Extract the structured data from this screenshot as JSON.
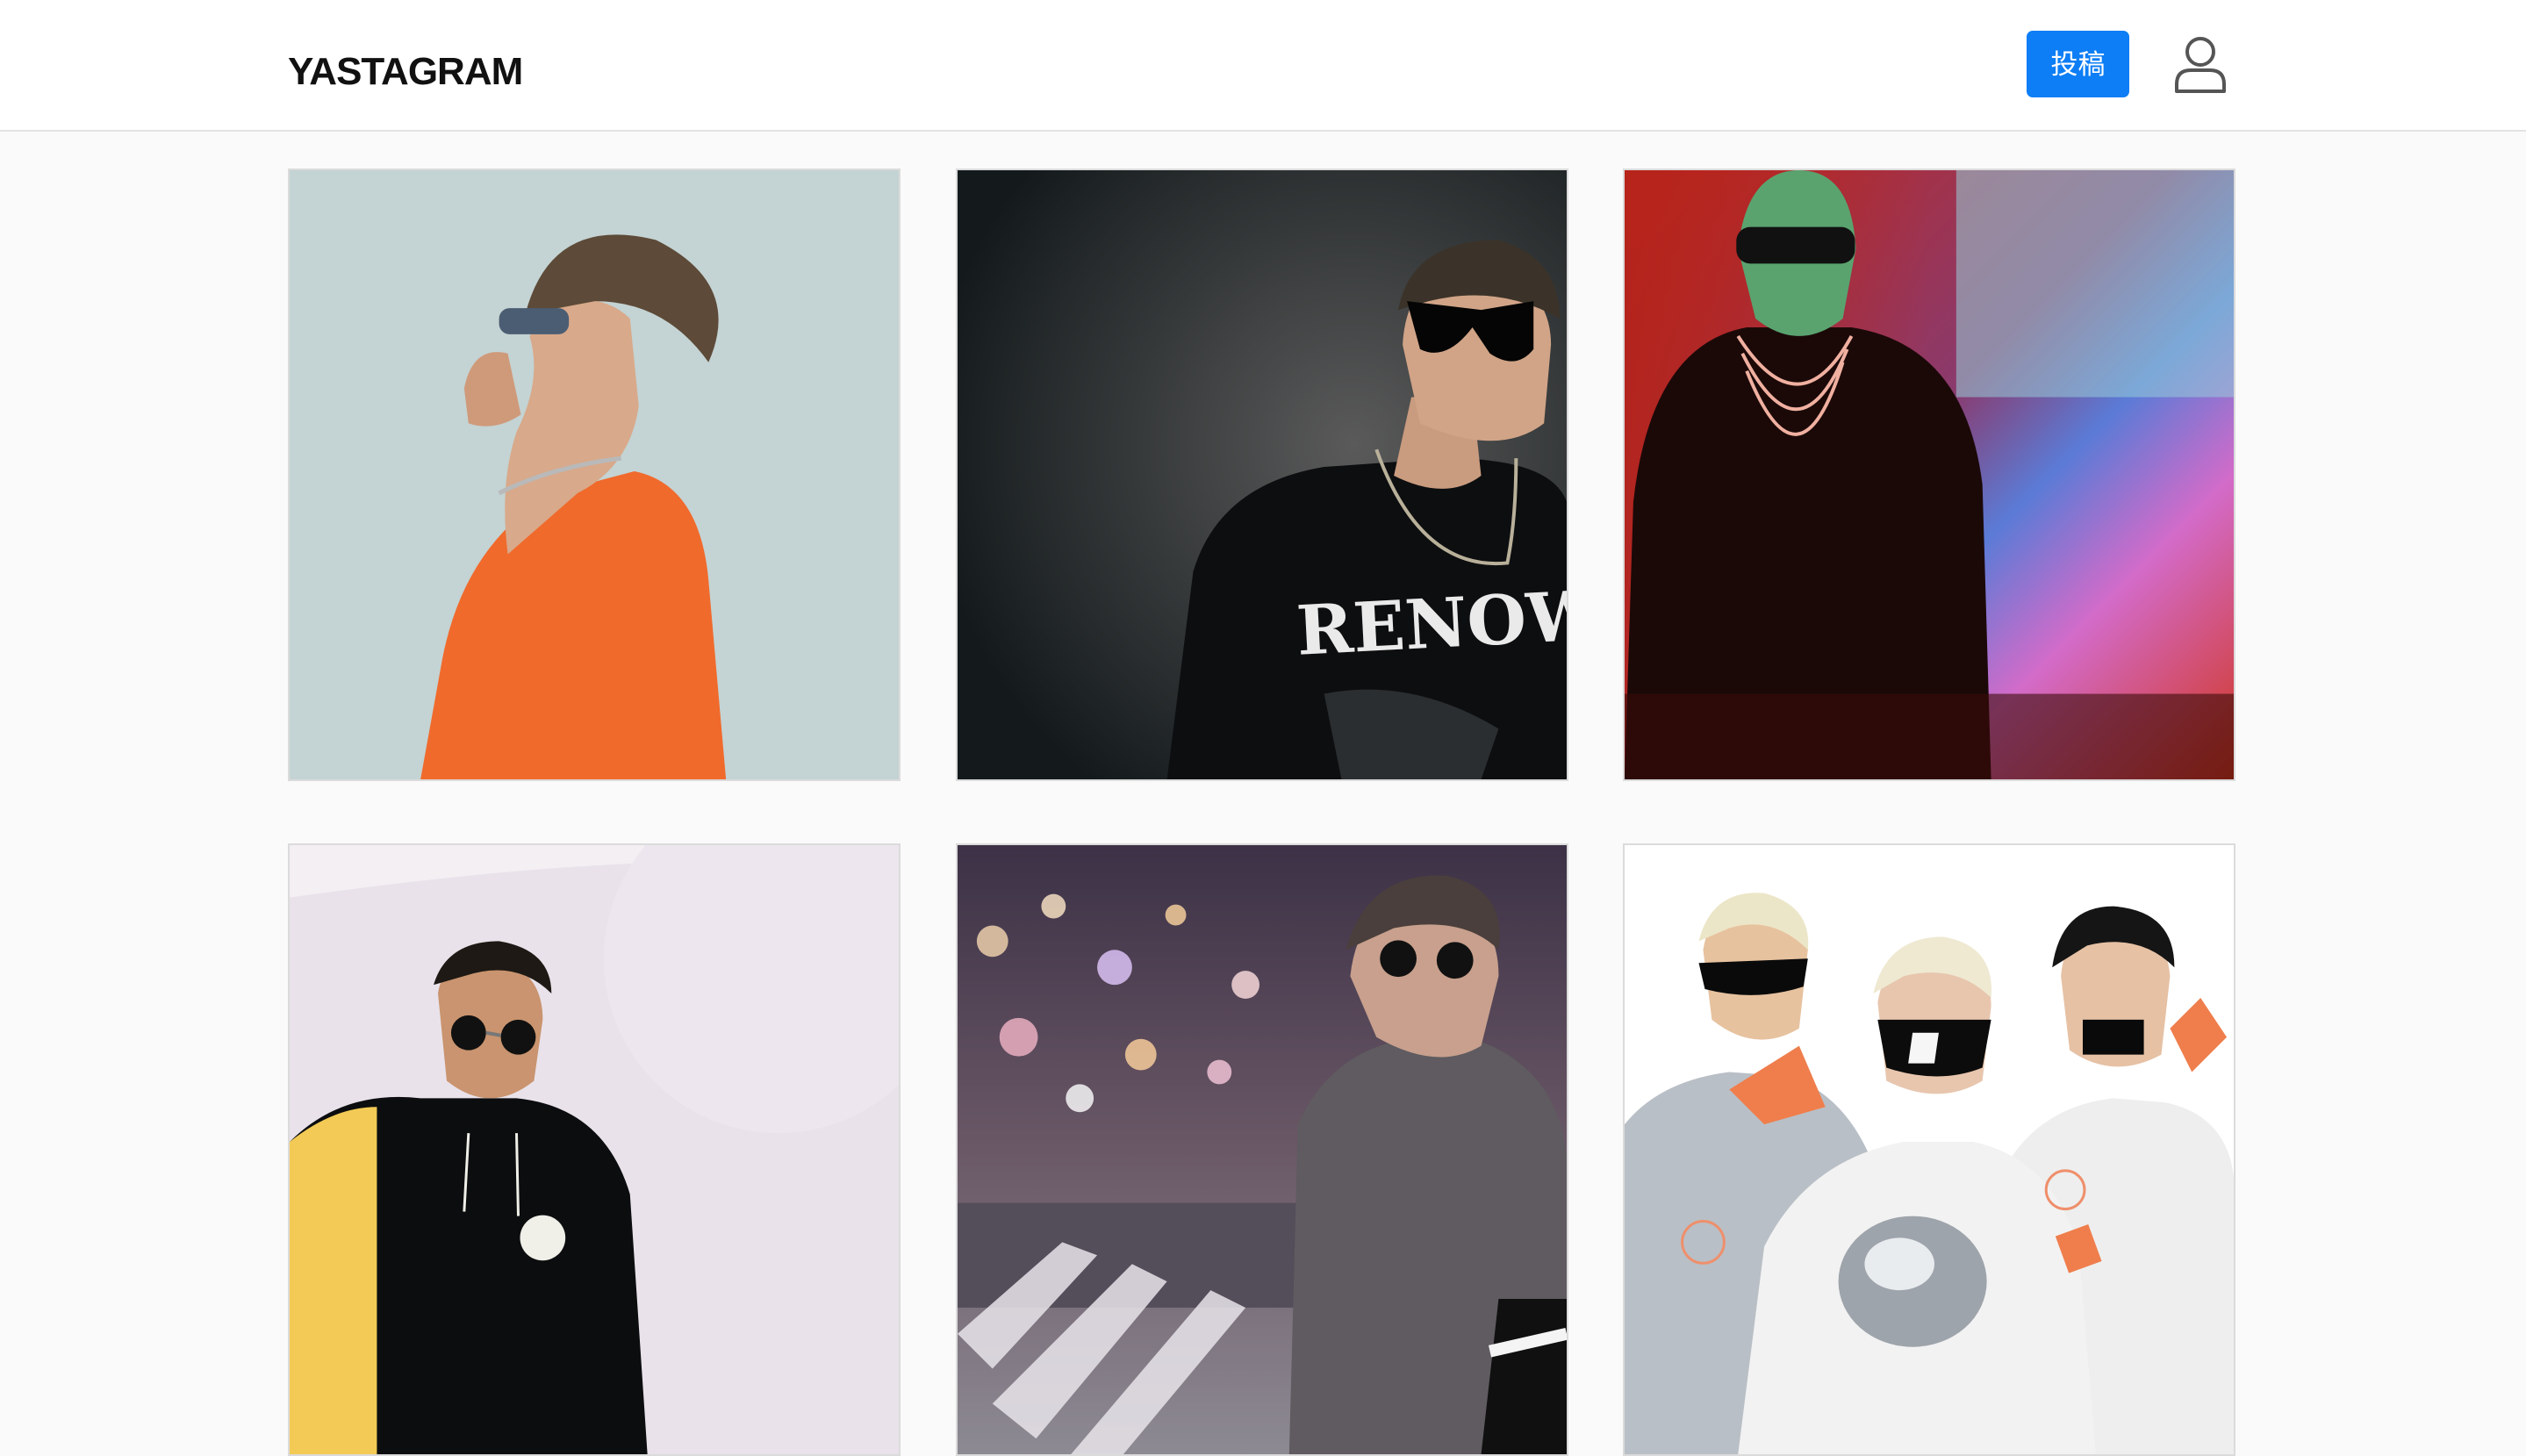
{
  "header": {
    "logo": "YASTAGRAM",
    "post_button_label": "投稿",
    "profile_icon": "user-icon"
  },
  "colors": {
    "accent": "#0d7ef5",
    "background": "#fafafa",
    "header_background": "#ffffff",
    "border": "#dbdbdb"
  },
  "feed": {
    "posts": [
      {
        "text_in_image": ""
      },
      {
        "text_in_image": "RENOWNE"
      },
      {
        "text_in_image": ""
      },
      {
        "text_in_image": ""
      },
      {
        "text_in_image": ""
      },
      {
        "text_in_image": ""
      }
    ]
  }
}
